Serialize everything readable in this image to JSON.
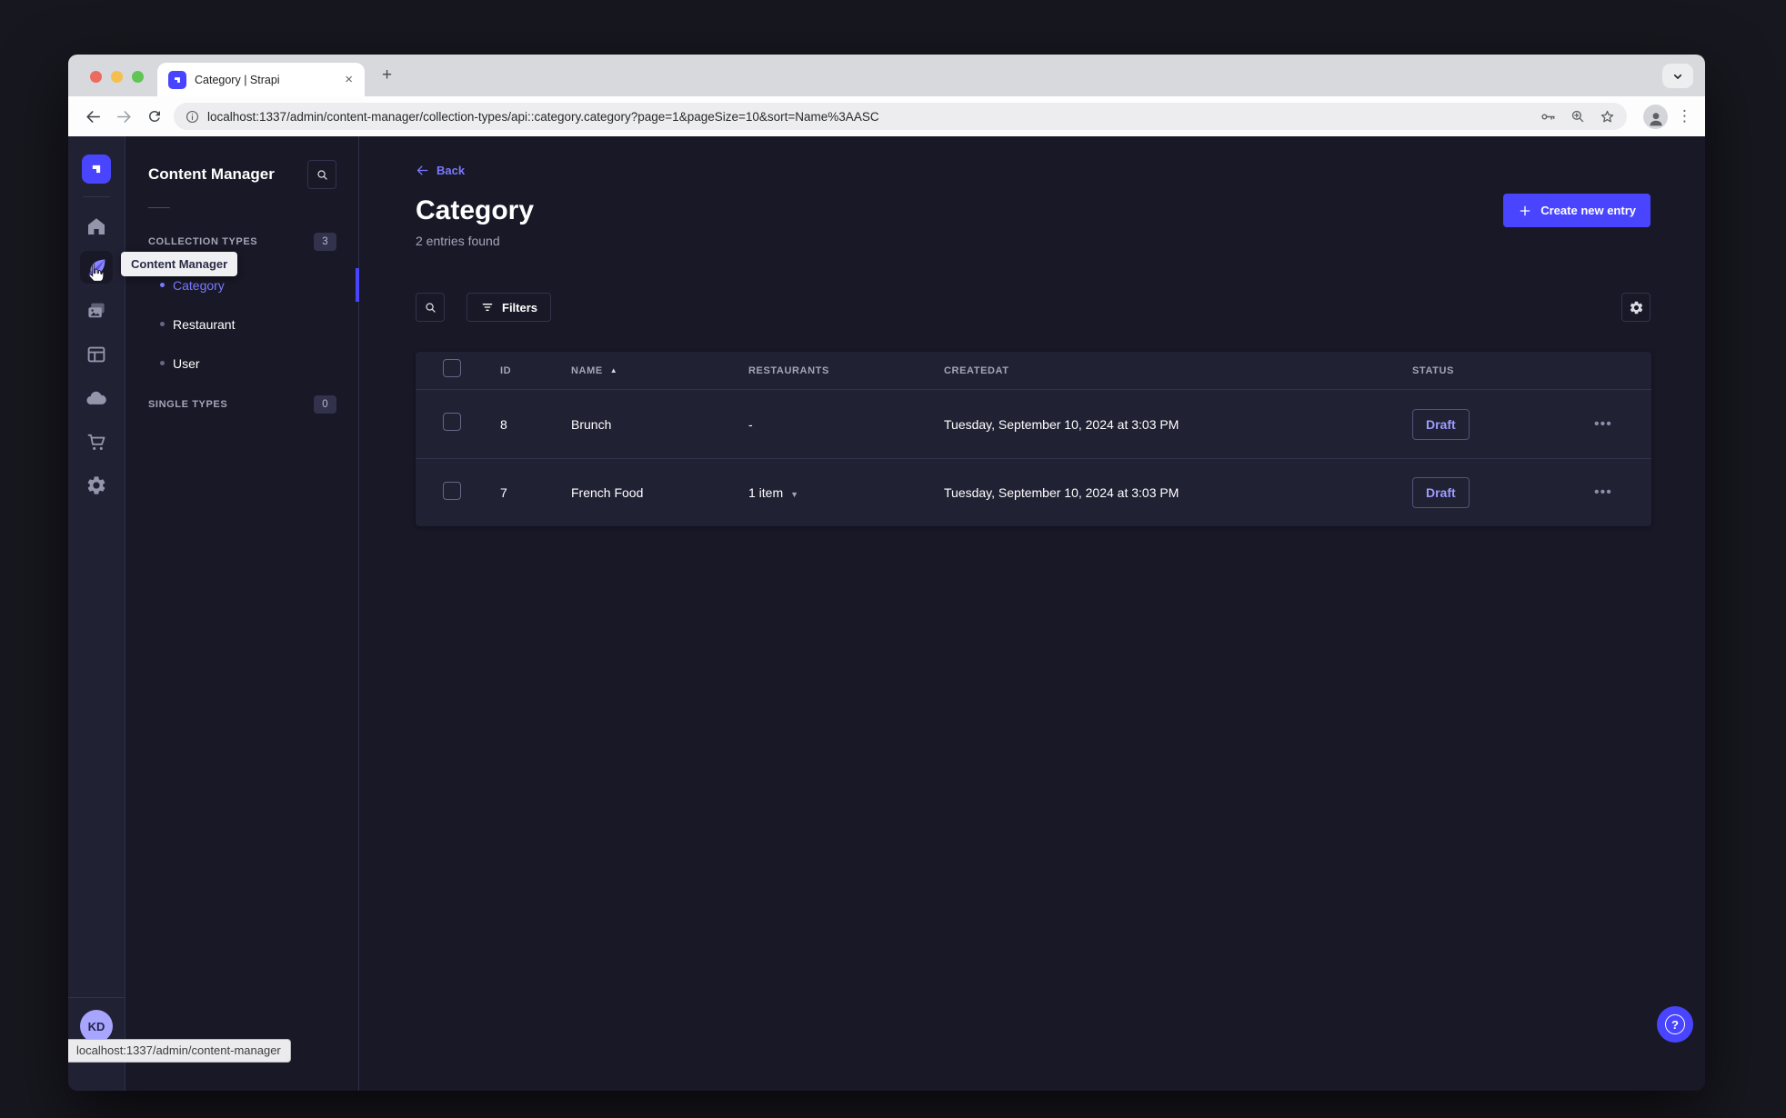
{
  "browser": {
    "tab_title": "Category | Strapi",
    "new_tab_icon": "+",
    "close_tab_icon": "×",
    "url": "localhost:1337/admin/content-manager/collection-types/api::category.category?page=1&pageSize=10&sort=Name%3AASC",
    "menu_dots_icon": "⋮",
    "status_bubble": "localhost:1337/admin/content-manager"
  },
  "colors": {
    "accent": "#4945ff",
    "link": "#7b79ff",
    "app_background": "#181826",
    "surface": "#212134",
    "border": "#32324d",
    "muted_text": "#a5a5ba"
  },
  "sidebar": {
    "tooltip": "Content Manager",
    "avatar_initials": "KD",
    "active_item": "content-manager"
  },
  "subnav": {
    "title": "Content Manager",
    "collection_section": {
      "label": "COLLECTION TYPES",
      "badge": "3",
      "items": [
        {
          "label": "Category",
          "active": true
        },
        {
          "label": "Restaurant",
          "active": false
        },
        {
          "label": "User",
          "active": false
        }
      ]
    },
    "single_section": {
      "label": "SINGLE TYPES",
      "badge": "0"
    }
  },
  "main": {
    "back_label": "Back",
    "title": "Category",
    "subtitle": "2 entries found",
    "create_button_label": "Create new entry",
    "filters_button_label": "Filters",
    "table": {
      "headers": [
        "ID",
        "NAME",
        "RESTAURANTS",
        "CREATEDAT",
        "STATUS"
      ],
      "sort_asc_icon": "▲",
      "caret_icon": "▼",
      "row_actions_icon": "•••",
      "rows": [
        {
          "id": "8",
          "name": "Brunch",
          "restaurants": "-",
          "createdAt": "Tuesday, September 10, 2024 at 3:03 PM",
          "status": "Draft"
        },
        {
          "id": "7",
          "name": "French Food",
          "restaurants": "1 item",
          "createdAt": "Tuesday, September 10, 2024 at 3:03 PM",
          "status": "Draft"
        }
      ]
    }
  }
}
